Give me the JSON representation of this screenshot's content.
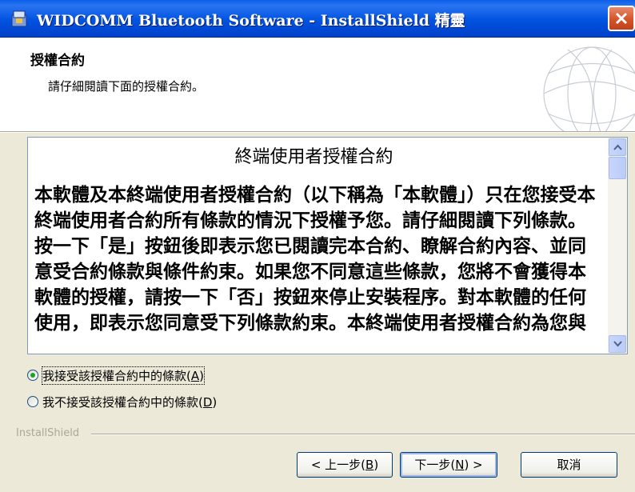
{
  "window": {
    "title": "WIDCOMM Bluetooth Software - InstallShield 精靈"
  },
  "header": {
    "title": "授權合約",
    "subtitle": "請仔細閱讀下面的授權合約。"
  },
  "license": {
    "heading": "終端使用者授權合約",
    "body": "本軟體及本終端使用者授權合約（以下稱為「本軟體」）只在您接受本終端使用者合約所有條款的情況下授權予您。請仔細閱讀下列條款。按一下「是」按鈕後即表示您已閱讀完本合約、瞭解合約內容、並同意受合約條款與條件約束。如果您不同意這些條款，您將不會獲得本軟體的授權，請按一下「否」按鈕來停止安裝程序。對本軟體的任何使用，即表示您同意受下列條款約束。本終端使用者授權合約為您與"
  },
  "options": {
    "accept": {
      "text": "我接受該授權合約中的條款(",
      "key": "A",
      "end": ")",
      "checked": true
    },
    "decline": {
      "text": "我不接受該授權合約中的條款(",
      "key": "D",
      "end": ")",
      "checked": false
    }
  },
  "footer": {
    "brand": "InstallShield",
    "back": {
      "text": "< 上一步(",
      "key": "B",
      "end": ")"
    },
    "next": {
      "text": "下一步(",
      "key": "N",
      "end": ") >"
    },
    "cancel": "取消"
  },
  "colors": {
    "titlebar": "#0053e0",
    "close": "#d4532a",
    "dialog": "#ece9d8",
    "radio_dot": "#21a121"
  },
  "icons": [
    "installer-icon",
    "close-icon",
    "globe-icon",
    "scroll-up-icon",
    "scroll-down-icon"
  ]
}
